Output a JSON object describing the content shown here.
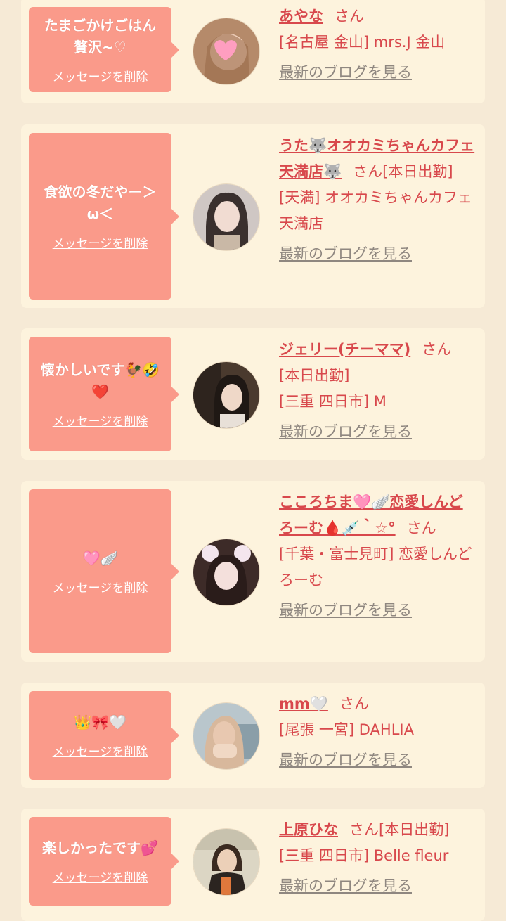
{
  "delete_label": "メッセージを削除",
  "blog_label": "最新のブログを見る",
  "colors": {
    "background": "#f6ead6",
    "card": "#fdf3dd",
    "bubble": "#fa9a8a",
    "name": "#d8484c",
    "blog_link": "#8f8780"
  },
  "cards": [
    {
      "message": "たまごかけごはん\n贅沢~♡",
      "name": "あやな",
      "san": "さん",
      "shop": "[名古屋 金山] mrs.J 金山"
    },
    {
      "message": "食欲の冬だやー＞\nω＜",
      "name": "うた🐺オオカミちゃんカフェ天満店🐺",
      "san": "さん[本日出勤]",
      "shop": "[天満] オオカミちゃんカフェ天満店"
    },
    {
      "message": "懐かしいです🐓🤣\n❤️",
      "name": "ジェリー(チーママ)",
      "san": "さん",
      "status": "[本日出勤]",
      "shop": "[三重 四日市] M"
    },
    {
      "message": "🩷🪽",
      "name": "こころちま🩷🪽恋愛しんどろーむ🩸💉｀☆°",
      "san": "さん",
      "shop": "[千葉・富士見町] 恋愛しんどろーむ"
    },
    {
      "message": "👑🎀🤍",
      "name": "mm🤍",
      "san": "さん",
      "shop": "[尾張 一宮] DAHLIA"
    },
    {
      "message": "楽しかったです💕",
      "name": "上原ひな",
      "san": "さん[本日出勤]",
      "shop": "[三重 四日市] Belle fleur"
    }
  ]
}
